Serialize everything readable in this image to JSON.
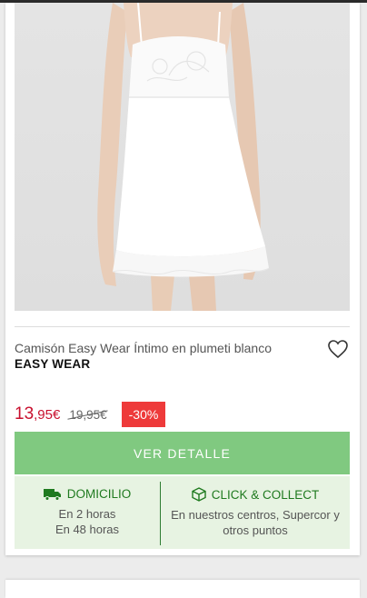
{
  "product": {
    "title": "Camisón Easy Wear Íntimo en plumeti blanco",
    "brand": "EASY WEAR",
    "price_now_int": "13",
    "price_now_dec": ",95€",
    "price_old": "19,95€",
    "discount": "-30%",
    "image_alt": "white plumeti nightdress on model"
  },
  "cta": {
    "label": "VER DETALLE"
  },
  "delivery": {
    "home": {
      "heading": "DOMICILIO",
      "icon": "truck-icon",
      "lines": [
        "En 2 horas",
        "En 48 horas"
      ]
    },
    "collect": {
      "heading": "CLICK & COLLECT",
      "icon": "box-icon",
      "lines": [
        "En nuestros centros, Supercor y",
        "otros puntos"
      ]
    }
  },
  "colors": {
    "accent_green": "#80c980",
    "heading_green": "#1f7a1f",
    "panel_green": "#e7f3e2",
    "price_red": "#c8102e",
    "discount_red": "#ee3a3a"
  }
}
